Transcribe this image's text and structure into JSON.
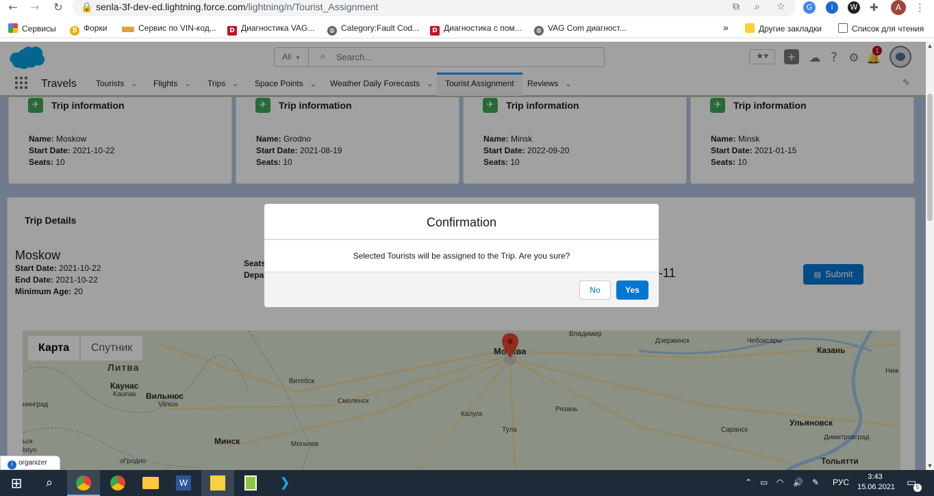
{
  "browser": {
    "url_host": "senla-3f-dev-ed.lightning.force.com",
    "url_path": "/lightning/n/Tourist_Assignment",
    "profile_initial": "A",
    "bookmarks": [
      {
        "label": "Сервисы",
        "icon": "apps-grid-icon"
      },
      {
        "label": "Форки",
        "icon": "coin-icon"
      },
      {
        "label": "Сервис по VIN-код...",
        "icon": "car-icon"
      },
      {
        "label": "Диагностика VAG...",
        "icon": "d-icon"
      },
      {
        "label": "Category:Fault Cod...",
        "icon": "globe-icon"
      },
      {
        "label": "Диагностика с пом...",
        "icon": "d-icon"
      },
      {
        "label": "VAG Com диагност...",
        "icon": "globe-icon"
      }
    ],
    "bookmarks_more": "»",
    "other_bookmarks": "Другие закладки",
    "reading_list": "Список для чтения"
  },
  "sf": {
    "search_scope": "All",
    "search_placeholder": "Search...",
    "notification_count": "1",
    "app_name": "Travels",
    "nav": [
      {
        "label": "Tourists",
        "has_menu": true
      },
      {
        "label": "Flights",
        "has_menu": true
      },
      {
        "label": "Trips",
        "has_menu": true
      },
      {
        "label": "Space Points",
        "has_menu": true
      },
      {
        "label": "Weather Daily Forecasts",
        "has_menu": true
      },
      {
        "label": "Tourist Assignment",
        "has_menu": false,
        "active": true
      },
      {
        "label": "Reviews",
        "has_menu": true
      }
    ]
  },
  "trip_cards": [
    {
      "title": "Trip information",
      "name_label": "Name:",
      "name": "Moskow",
      "start_label": "Start Date:",
      "start": "2021-10-22",
      "seats_label": "Seats:",
      "seats": "10"
    },
    {
      "title": "Trip information",
      "name_label": "Name:",
      "name": "Grodno",
      "start_label": "Start Date:",
      "start": "2021-08-19",
      "seats_label": "Seats:",
      "seats": "10"
    },
    {
      "title": "Trip information",
      "name_label": "Name:",
      "name": "Minsk",
      "start_label": "Start Date:",
      "start": "2022-09-20",
      "seats_label": "Seats:",
      "seats": "10"
    },
    {
      "title": "Trip information",
      "name_label": "Name:",
      "name": "Minsk",
      "start_label": "Start Date:",
      "start": "2021-01-15",
      "seats_label": "Seats:",
      "seats": "10"
    }
  ],
  "trip_details": {
    "heading": "Trip Details",
    "city": "Moskow",
    "start_label": "Start Date:",
    "start": "2021-10-22",
    "end_label": "End Date:",
    "end": "2021-10-22",
    "min_age_label": "Minimum Age:",
    "min_age": "20",
    "seats_label": "Seats",
    "departure_label": "Depa",
    "tail_text": "-11",
    "submit_label": "Submit"
  },
  "map": {
    "tab_map": "Карта",
    "tab_satellite": "Спутник",
    "labels": {
      "lithuania": "Литва",
      "kaunas": "Каунас",
      "kaunas_latin": "Kaunas",
      "vilnius": "Вильнюс",
      "vilnius_latin": "Vilnius",
      "kaliningrad": "нинград",
      "vitebsk": "Витебск",
      "smolensk": "Смоленск",
      "minsk": "Минск",
      "mogilev": "Могилев",
      "grodno": "оГродно",
      "lstyn": "lstyn",
      "minsk_prefix": "ьск",
      "moscow": "Москва",
      "vladimir": "Владимир",
      "dzerzhinsk": "Дзержинск",
      "cheboksary": "Чебоксары",
      "kazan": "Казань",
      "kaluga": "Калуга",
      "ryazan": "Рязань",
      "tula": "Тула",
      "saransk": "Саранск",
      "ulyanovsk": "Ульяновск",
      "dimitrovgrad": "Димитровград",
      "tolyatti": "Тольятти",
      "nizh": "Ниж"
    }
  },
  "modal": {
    "title": "Confirmation",
    "message": "Selected Tourists will be assigned to the Trip. Are you sure?",
    "no_label": "No",
    "yes_label": "Yes"
  },
  "organizer": {
    "label": "organizer"
  },
  "taskbar": {
    "time": "3:43",
    "date": "15.06.2021",
    "lang": "РУС",
    "notifications": "5"
  }
}
